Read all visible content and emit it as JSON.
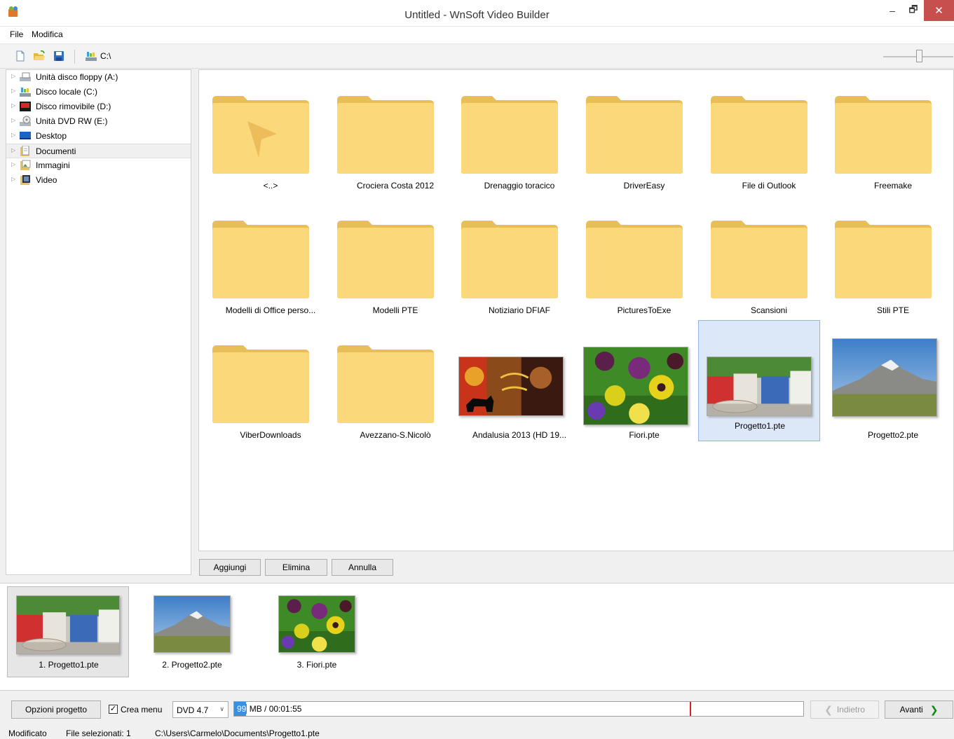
{
  "window": {
    "title": "Untitled - WnSoft Video Builder",
    "minimize_glyph": "–",
    "maximize_glyph": "🗗",
    "close_glyph": "✕"
  },
  "menu": [
    "File",
    "Modifica"
  ],
  "toolbar": {
    "icons": [
      "new-file-icon",
      "open-folder-icon",
      "save-icon",
      "drive-icon"
    ],
    "path": "C:\\",
    "zoom_level": 0.47
  },
  "tree": [
    {
      "label": "Unità disco floppy (A:)",
      "icon": "floppy-drive-icon"
    },
    {
      "label": "Disco locale (C:)",
      "icon": "local-disk-icon"
    },
    {
      "label": "Disco rimovibile (D:)",
      "icon": "removable-disk-icon"
    },
    {
      "label": "Unità DVD RW (E:)",
      "icon": "dvd-drive-icon"
    },
    {
      "label": "Desktop",
      "icon": "desktop-icon"
    },
    {
      "label": "Documenti",
      "icon": "documents-icon",
      "selected": true
    },
    {
      "label": "Immagini",
      "icon": "pictures-icon"
    },
    {
      "label": "Video",
      "icon": "video-icon"
    }
  ],
  "files": [
    {
      "label": "<..>",
      "type": "parent"
    },
    {
      "label": "Crociera Costa 2012",
      "type": "folder"
    },
    {
      "label": "Drenaggio toracico",
      "type": "folder"
    },
    {
      "label": "DriverEasy",
      "type": "folder"
    },
    {
      "label": "File di Outlook",
      "type": "folder"
    },
    {
      "label": "Freemake",
      "type": "folder"
    },
    {
      "label": "Modelli di Office perso...",
      "type": "folder"
    },
    {
      "label": "Modelli PTE",
      "type": "folder"
    },
    {
      "label": "Notiziario DFIAF",
      "type": "folder"
    },
    {
      "label": "PicturesToExe",
      "type": "folder"
    },
    {
      "label": "Scansioni",
      "type": "folder"
    },
    {
      "label": "Stili PTE",
      "type": "folder"
    },
    {
      "label": "ViberDownloads",
      "type": "folder"
    },
    {
      "label": "Avezzano-S.Nicolò",
      "type": "folder"
    },
    {
      "label": "Andalusia 2013 (HD 19...",
      "type": "andalusia"
    },
    {
      "label": "Fiori.pte",
      "type": "flowers"
    },
    {
      "label": "Progetto1.pte",
      "type": "courtyard",
      "selected": true
    },
    {
      "label": "Progetto2.pte",
      "type": "mountain"
    }
  ],
  "actions": {
    "add": "Aggiungi",
    "remove": "Elimina",
    "cancel": "Annulla"
  },
  "slides": [
    {
      "label": "1. Progetto1.pte",
      "type": "courtyard",
      "selected": true
    },
    {
      "label": "2. Progetto2.pte",
      "type": "mountain"
    },
    {
      "label": "3. Fiori.pte",
      "type": "flowers"
    }
  ],
  "bottom": {
    "options_label": "Opzioni progetto",
    "create_menu_label": "Crea menu",
    "create_menu_checked": "✓",
    "dvd_value": "DVD 4.7",
    "dvd_chevron": "∨",
    "progress_number": "99",
    "progress_text": "MB / 00:01:55",
    "progress_fraction": 0.021,
    "marker_fraction": 0.8,
    "back_label": "Indietro",
    "next_label": "Avanti",
    "back_chevron": "❮",
    "next_chevron": "❯",
    "accent": "#3a8fe0",
    "marker_color": "#d9202a"
  },
  "status": {
    "state": "Modificato",
    "selected": "File selezionati: 1",
    "path": "C:\\Users\\Carmelo\\Documents\\Progetto1.pte"
  }
}
